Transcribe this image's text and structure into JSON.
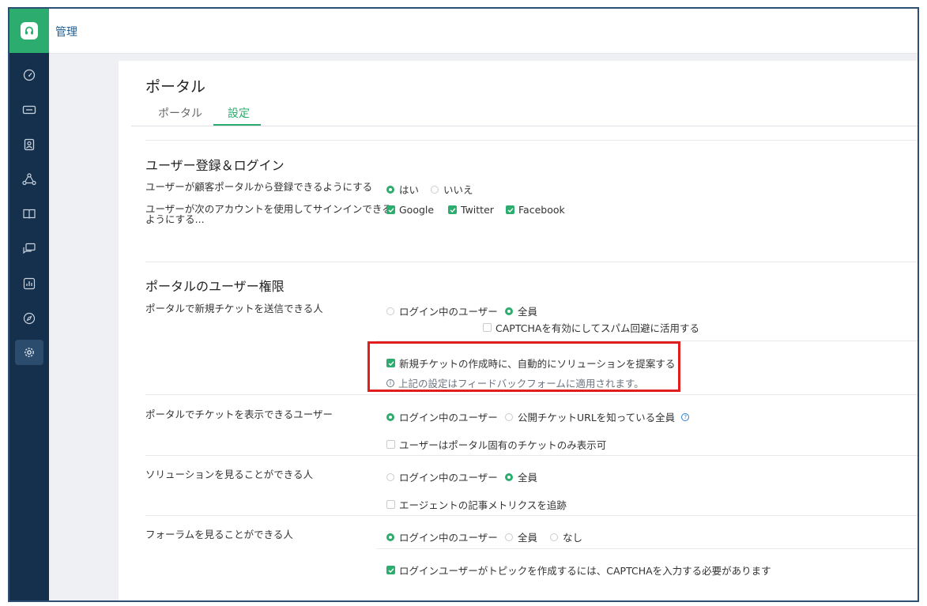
{
  "topbar": {
    "title": "管理"
  },
  "sidebar": {
    "items": [
      {
        "icon": "speedometer-icon"
      },
      {
        "icon": "ticket-icon"
      },
      {
        "icon": "contact-icon"
      },
      {
        "icon": "network-icon"
      },
      {
        "icon": "book-icon"
      },
      {
        "icon": "chat-icon"
      },
      {
        "icon": "report-icon"
      },
      {
        "icon": "compass-icon"
      },
      {
        "icon": "gear-icon",
        "active": true
      }
    ]
  },
  "page": {
    "title": "ポータル",
    "tabs": [
      {
        "label": "ポータル",
        "active": false
      },
      {
        "label": "設定",
        "active": true
      }
    ]
  },
  "registration": {
    "title": "ユーザー登録＆ログイン",
    "signup_label": "ユーザーが顧客ポータルから登録できるようにする",
    "signup_options": [
      "はい",
      "いいえ"
    ],
    "signup_selected": "はい",
    "signin_label_line1": "ユーザーが次のアカウントを使用してサインインできる",
    "signin_label_line2": "ようにする...",
    "signin_options": [
      "Google",
      "Twitter",
      "Facebook"
    ]
  },
  "permissions": {
    "title": "ポータルのユーザー権限",
    "new_ticket": {
      "label": "ポータルで新規チケットを送信できる人",
      "options": [
        "ログイン中のユーザー",
        "全員"
      ],
      "selected": "全員",
      "captcha": "CAPTCHAを有効にしてスパム回避に活用する",
      "suggest": "新規チケットの作成時に、自動的にソリューションを提案する",
      "info": "上記の設定はフィードバックフォームに適用されます。"
    },
    "view_tickets": {
      "label": "ポータルでチケットを表示できるユーザー",
      "options": [
        "ログイン中のユーザー",
        "公開チケットURLを知っている全員"
      ],
      "selected": "ログイン中のユーザー",
      "portal_only": "ユーザーはポータル固有のチケットのみ表示可"
    },
    "solutions": {
      "label": "ソリューションを見ることができる人",
      "options": [
        "ログイン中のユーザー",
        "全員"
      ],
      "selected": "全員",
      "metrics": "エージェントの記事メトリクスを追跡"
    },
    "forums": {
      "label": "フォーラムを見ることができる人",
      "options": [
        "ログイン中のユーザー",
        "全員",
        "なし"
      ],
      "selected": "ログイン中のユーザー",
      "captcha": "ログインユーザーがトピックを作成するには、CAPTCHAを入力する必要があります"
    }
  },
  "colors": {
    "accent": "#2cac6e",
    "sidebar": "#15304c",
    "highlight": "#e01e1e"
  }
}
